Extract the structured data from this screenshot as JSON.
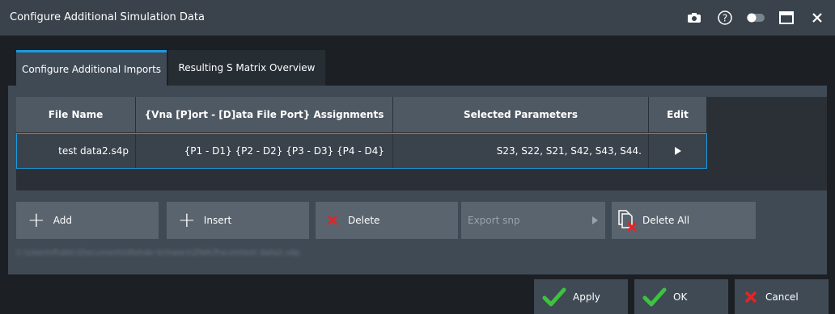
{
  "window": {
    "title": "Configure Additional Simulation Data",
    "icons": [
      "camera-icon",
      "help-icon",
      "toggle-icon",
      "maximize-icon",
      "close-icon"
    ]
  },
  "tabs": [
    {
      "label": "Configure Additional Imports",
      "active": true
    },
    {
      "label": "Resulting S Matrix Overview",
      "active": false
    }
  ],
  "table": {
    "columns": [
      "File Name",
      "{Vna [P]ort - [D]ata File Port} Assignments",
      "Selected Parameters",
      "Edit"
    ],
    "rows": [
      {
        "file_name": "test data2.s4p",
        "assignments": "{P1 - D1} {P2 - D2} {P3 - D3} {P4 - D4}",
        "parameters": "S23, S22, S21, S42, S43, S44.",
        "edit_icon": "play-arrow-icon"
      }
    ]
  },
  "buttons": {
    "add": "Add",
    "insert": "Insert",
    "delete": "Delete",
    "export": "Export snp",
    "delete_all": "Delete All"
  },
  "dialog_buttons": {
    "apply": "Apply",
    "ok": "OK",
    "cancel": "Cancel"
  },
  "colors": {
    "accent": "#1a9be0",
    "check_green": "#3cc43c",
    "delete_red": "#e82323"
  }
}
